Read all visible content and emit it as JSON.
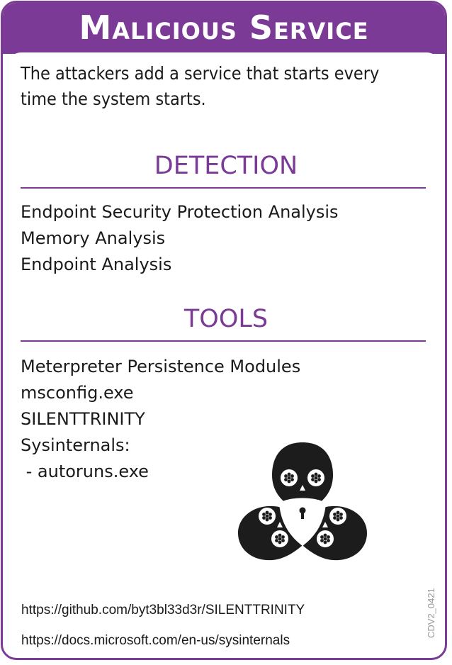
{
  "title": "Malicious Service",
  "description": "The attackers add a service that starts every time the system starts.",
  "detection": {
    "heading": "DETECTION",
    "items": [
      "Endpoint Security Protection Analysis",
      "Memory Analysis",
      "Endpoint Analysis"
    ]
  },
  "tools": {
    "heading": "TOOLS",
    "items": [
      "Meterpreter Persistence Modules",
      "msconfig.exe",
      "SILENTTRINITY",
      "Sysinternals:",
      " - autoruns.exe"
    ]
  },
  "links": [
    "https://github.com/byt3bl33d3r/SILENTTRINITY",
    "https://docs.microsoft.com/en-us/sysinternals"
  ],
  "card_code": "CDV2_0421",
  "colors": {
    "accent": "#7b3a96",
    "text": "#1a1a1a",
    "icon": "#1c1c1c"
  },
  "icon": "skull-lock-trefoil-icon"
}
